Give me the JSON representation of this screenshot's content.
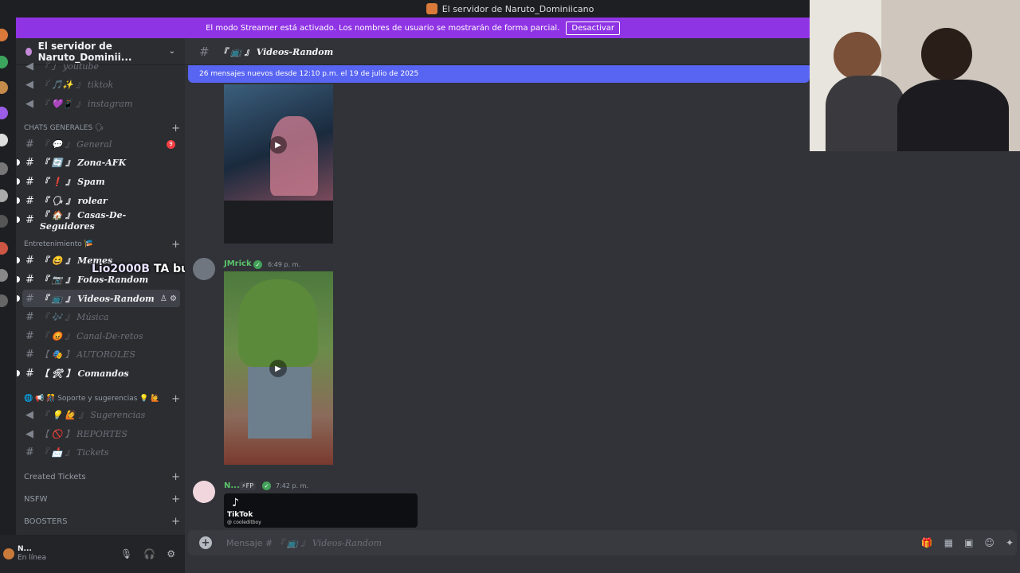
{
  "window": {
    "title": "El servidor de Naruto_Dominiicano"
  },
  "banner": {
    "text": "El modo Streamer está activado. Los nombres de usuario se mostrarán de forma parcial.",
    "button": "Desactivar"
  },
  "server": {
    "name": "El servidor de Naruto_Dominii..."
  },
  "channels_top": [
    {
      "label": "『 」 youtube"
    },
    {
      "label": "『 🎵✨ 』 tiktok"
    },
    {
      "label": "『 💜📱 』 instagram"
    }
  ],
  "categories": {
    "chats": "CHATS GENERALES 🗣",
    "entretenimiento": "Entretenimiento 🎏",
    "soporte": "🌐 📢 🎊 Soporte y sugerencias 💡 🙋",
    "created": "Created Tickets",
    "nsfw": "NSFW",
    "boosters": "BOOSTERS"
  },
  "chats_channels": [
    {
      "label": "『 💬 』 General",
      "badge": "9"
    },
    {
      "label": "『 🔄 』 Zona-AFK"
    },
    {
      "label": "『 ❗ 』 Spam"
    },
    {
      "label": "『 🗣 』 rolear"
    },
    {
      "label": "『 🏠 』 Casas-De-Seguidores"
    }
  ],
  "ent_channels": [
    {
      "label": "『 😆 』 Memes"
    },
    {
      "label": "『 📷 』 Fotos-Random"
    },
    {
      "label": "『 📺 』 Videos-Random"
    },
    {
      "label": "『 🎶 』 Música"
    },
    {
      "label": "『 😡 』 Canal-De-retos"
    },
    {
      "label": "【 🎭 】 AUTOROLES"
    },
    {
      "label": "【 🛠 】 Comandos"
    }
  ],
  "support_channels": [
    {
      "label": "『 💡 🙋 』 Sugerencias"
    },
    {
      "label": "【 🚫 】 REPORTES"
    },
    {
      "label": "『 📩 』 Tickets"
    }
  ],
  "user": {
    "name": "N...",
    "status": "En línea"
  },
  "header": {
    "channel": "『 📺 』 Videos-Random"
  },
  "new_messages": "26 mensajes nuevos desde 12:10 p.m. el 19 de julio de 2025",
  "messages": [
    {
      "author": "JMrick",
      "time": "6:49 p. m.",
      "color": "#5bc46a"
    },
    {
      "author": "N...",
      "role": "⚡FP",
      "time": "7:42 p. m.",
      "color": "#5bc46a"
    }
  ],
  "tiktok": {
    "label": "TikTok",
    "user": "@ cooleditboy"
  },
  "overlay": {
    "who": "Lio2000B",
    "text": "TA buena esa"
  },
  "composer": {
    "placeholder_prefix": "Mensaje #",
    "placeholder_channel": "『 📺 』 Videos-Random"
  },
  "colors": {
    "accent": "#5865f2",
    "banner": "#8f34e4",
    "sidebar": "#2b2d31",
    "main": "#313338"
  }
}
